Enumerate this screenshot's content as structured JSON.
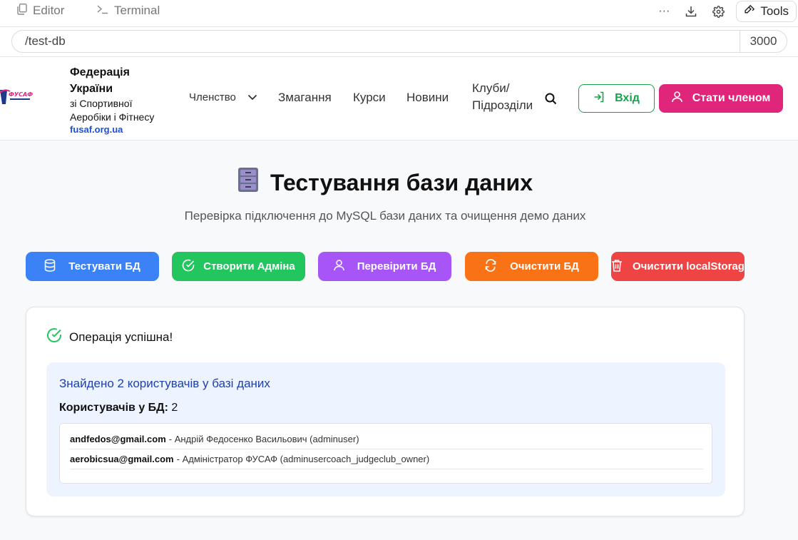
{
  "ide": {
    "tabs": [
      {
        "label": "Editor",
        "icon": "copy-icon"
      },
      {
        "label": "Terminal",
        "icon": "terminal-icon"
      }
    ],
    "tools_label": "Tools"
  },
  "url": {
    "path": "/test-db",
    "port": "3000"
  },
  "header": {
    "logo_text": "ФУСАФ",
    "org_title_line1": "Федерація",
    "org_title_line2": "України",
    "org_sub_line1": "зі Спортивної",
    "org_sub_line2": "Аеробіки і Фітнесу",
    "org_link": "fusaf.org.ua",
    "nav": {
      "membership": "Членство",
      "competitions": "Змагання",
      "courses": "Курси",
      "news": "Новини",
      "clubs_line1": "Клуби/",
      "clubs_line2": "Підрозділи"
    },
    "login_label": "Вхід",
    "join_label": "Стати членом",
    "colors": {
      "login": "#16a34a",
      "join": "#e0267a"
    }
  },
  "main": {
    "title": "Тестування бази даних",
    "subtitle": "Перевірка підключення до MySQL бази даних та очищення демо даних",
    "actions": [
      {
        "label": "Тестувати БД",
        "icon": "database-icon",
        "color": "#3b82f6"
      },
      {
        "label": "Створити Адміна",
        "icon": "check-circle-icon",
        "color": "#22c55e"
      },
      {
        "label": "Перевірити БД",
        "icon": "user-icon",
        "color": "#a855f7"
      },
      {
        "label": "Очистити БД",
        "icon": "refresh-icon",
        "color": "#f97316"
      },
      {
        "label": "Очистити localStorage",
        "icon": "trash-icon",
        "color": "#ef4444"
      }
    ],
    "status": "Операція успішна!",
    "result_title": "Знайдено 2 користувачів у базі даних",
    "count_label": "Користувачів у БД:",
    "count_value": "2",
    "users": [
      {
        "email": "andfedos@gmail.com",
        "details": "- Андрій Федосенко Васильович (adminuser)"
      },
      {
        "email": "aerobicsua@gmail.com",
        "details": "- Адміністратор ФУСАФ (adminusercoach_judgeclub_owner)"
      }
    ]
  }
}
